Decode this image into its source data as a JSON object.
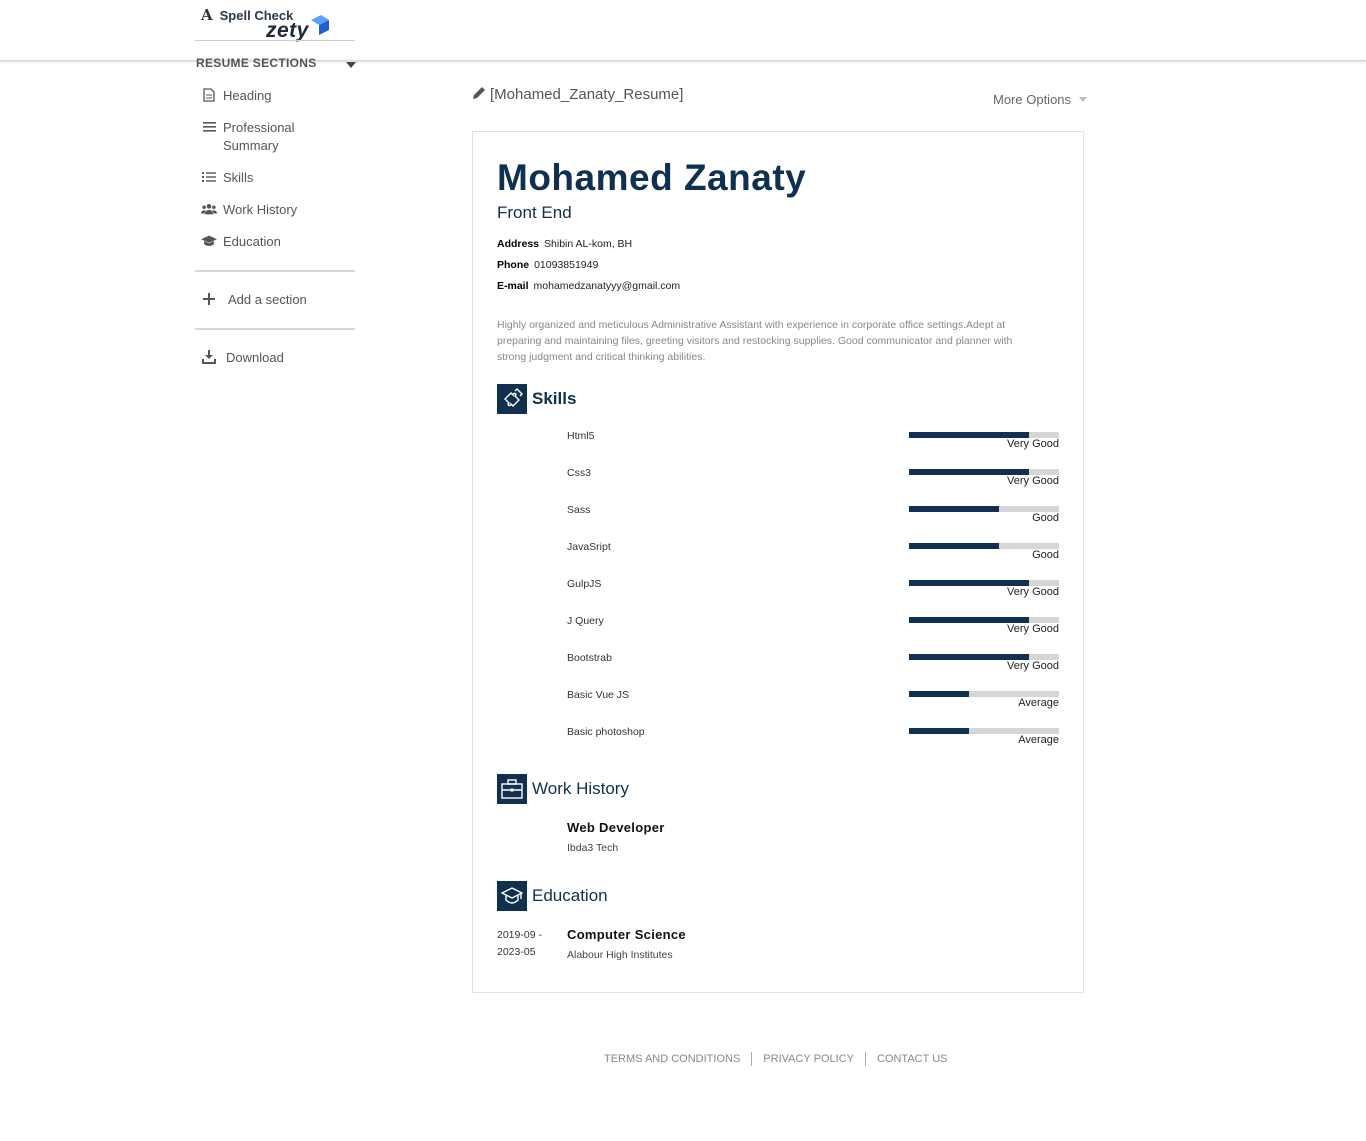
{
  "topbar": {
    "spell_check_label": "Spell Check",
    "logo_text": "zety"
  },
  "sidebar": {
    "sections_title": "RESUME SECTIONS",
    "items": [
      {
        "label": "Heading",
        "icon": "document-icon"
      },
      {
        "label": "Professional Summary",
        "icon": "list-lines-icon"
      },
      {
        "label": "Skills",
        "icon": "list-icon"
      },
      {
        "label": "Work History",
        "icon": "users-icon"
      },
      {
        "label": "Education",
        "icon": "graduation-cap-icon"
      }
    ],
    "add_section_label": "Add a section",
    "download_label": "Download"
  },
  "document": {
    "title": "[Mohamed_Zanaty_Resume]",
    "more_options_label": "More Options"
  },
  "resume": {
    "name": "Mohamed Zanaty",
    "job_title": "Front End",
    "contact": {
      "address_label": "Address",
      "address": "Shibin AL-kom, BH",
      "phone_label": "Phone",
      "phone": "01093851949",
      "email_label": "E-mail",
      "email": "mohamedzanatyyy@gmail.com"
    },
    "summary": "Highly organized and meticulous Administrative Assistant with experience in corporate office settings.Adept at preparing and maintaining files, greeting visitors and restocking supplies. Good communicator and planner with strong judgment and critical thinking abilities.",
    "skills_heading": "Skills",
    "skills": [
      {
        "name": "Html5",
        "level": "Very Good",
        "fill": 0.8
      },
      {
        "name": "Css3",
        "level": "Very Good",
        "fill": 0.8
      },
      {
        "name": "Sass",
        "level": "Good",
        "fill": 0.6
      },
      {
        "name": "JavaSript",
        "level": "Good",
        "fill": 0.6
      },
      {
        "name": "GulpJS",
        "level": "Very Good",
        "fill": 0.8
      },
      {
        "name": "J Query",
        "level": "Very Good",
        "fill": 0.8
      },
      {
        "name": "Bootstrab",
        "level": "Very Good",
        "fill": 0.8
      },
      {
        "name": "Basic Vue JS",
        "level": "Average",
        "fill": 0.4
      },
      {
        "name": "Basic photoshop",
        "level": "Average",
        "fill": 0.4
      }
    ],
    "work_heading": "Work History",
    "work": {
      "title": "Web Developer",
      "company": "Ibda3 Tech"
    },
    "education_heading": "Education",
    "education": {
      "date_start": "2019-09 -",
      "date_end": "2023-05",
      "degree": "Computer Science",
      "school": "Alabour High Institutes"
    }
  },
  "footer": {
    "terms": "TERMS AND CONDITIONS",
    "privacy": "PRIVACY POLICY",
    "contact": "CONTACT US"
  },
  "colors": {
    "accent": "#10304f",
    "bar_track": "#d6d6d6",
    "logo_blue": "#2f7ae5"
  }
}
